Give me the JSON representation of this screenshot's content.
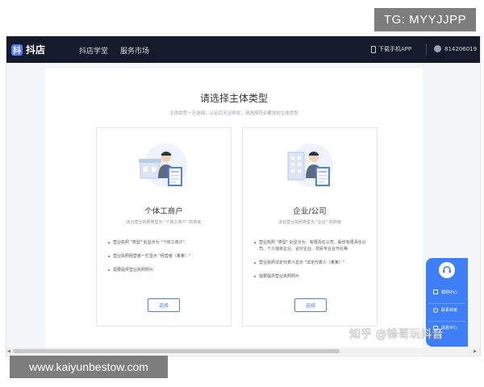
{
  "overlay": {
    "tag": "TG: MYYJJPP",
    "url": "www.kaiyunbestow.com",
    "watermark": "知乎 @锋哥玩抖音"
  },
  "nav": {
    "brand_mark": "抖",
    "brand_name": "抖店",
    "items": [
      "抖店学堂",
      "服务市场"
    ],
    "download_app": "下载手机APP",
    "account_id": "814206019"
  },
  "page": {
    "title": "请选择主体类型",
    "subtitle": "主体类型一旦选择，认证后无法修改，请选择符合要求的主体类型"
  },
  "cards": [
    {
      "title": "个体工商户",
      "description": "适合营业执照类型为 \"个体工商户\" 的商家",
      "bullets": [
        "营业执照 \"类型\" 处显示为 \"个体工商户\"",
        "营业执照经营者一栏显示 \"经营者（某某）\"",
        "需要提供营业执照照片"
      ],
      "button": "选择"
    },
    {
      "title": "企业/公司",
      "description": "适合营业执照类型为 \"企业\" 的商家",
      "bullets": [
        "营业执照 \"类型\" 处显示为：有限责任公司、股份有限责任公司、个人独资企业、合伙企业、农民专业合作社等",
        "营业执照法定代表人显示 \"法定代表人（某某）\"",
        "需要提供营业执照照片"
      ],
      "button": "选择"
    }
  ],
  "float_widget": {
    "items": [
      "帮助中心",
      "联系商家",
      "消息中心"
    ]
  },
  "colors": {
    "nav_bg": "#161b2c",
    "accent": "#4f7cf7",
    "widget": "#3e7ef6"
  }
}
